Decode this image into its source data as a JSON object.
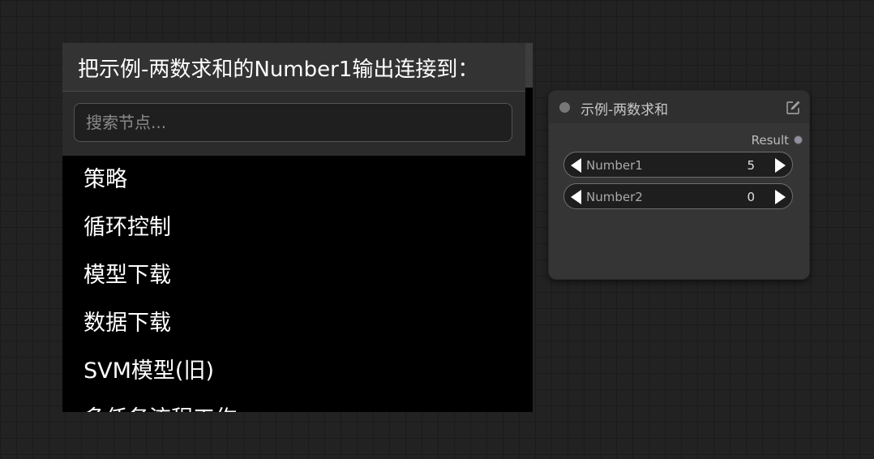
{
  "dialog": {
    "title": "把示例-两数求和的Number1输出连接到：",
    "search_placeholder": "搜索节点...",
    "results": [
      "策略",
      "循环控制",
      "模型下载",
      "数据下载",
      "SVM模型(旧)",
      "多任务流程工作"
    ]
  },
  "node": {
    "title": "示例-两数求和",
    "output_label": "Result",
    "widgets": [
      {
        "label": "Number1",
        "value": "5"
      },
      {
        "label": "Number2",
        "value": "0"
      }
    ]
  }
}
